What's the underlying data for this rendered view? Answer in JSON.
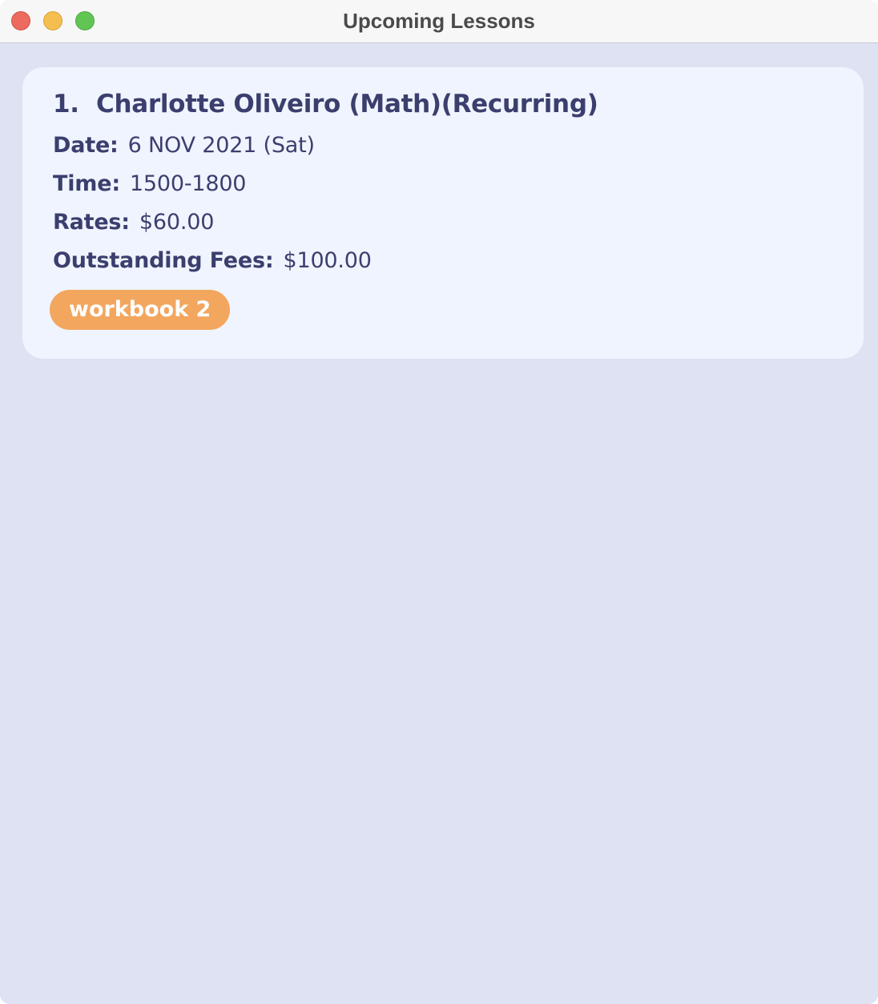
{
  "window": {
    "title": "Upcoming Lessons",
    "controls": [
      "close",
      "minimize",
      "maximize"
    ]
  },
  "colors": {
    "background": "#dfe2f3",
    "card": "#f0f4fe",
    "text": "#3b3f6e",
    "tag": "#f2a65e"
  },
  "lessons": [
    {
      "index": "1.",
      "title": "Charlotte Oliveiro (Math)(Recurring)",
      "date_label": "Date:",
      "date": "6 NOV 2021 (Sat)",
      "time_label": "Time:",
      "time": "1500-1800",
      "rates_label": "Rates:",
      "rates": "$60.00",
      "fees_label": "Outstanding Fees:",
      "fees": "$100.00",
      "tags": [
        "workbook 2"
      ]
    }
  ]
}
